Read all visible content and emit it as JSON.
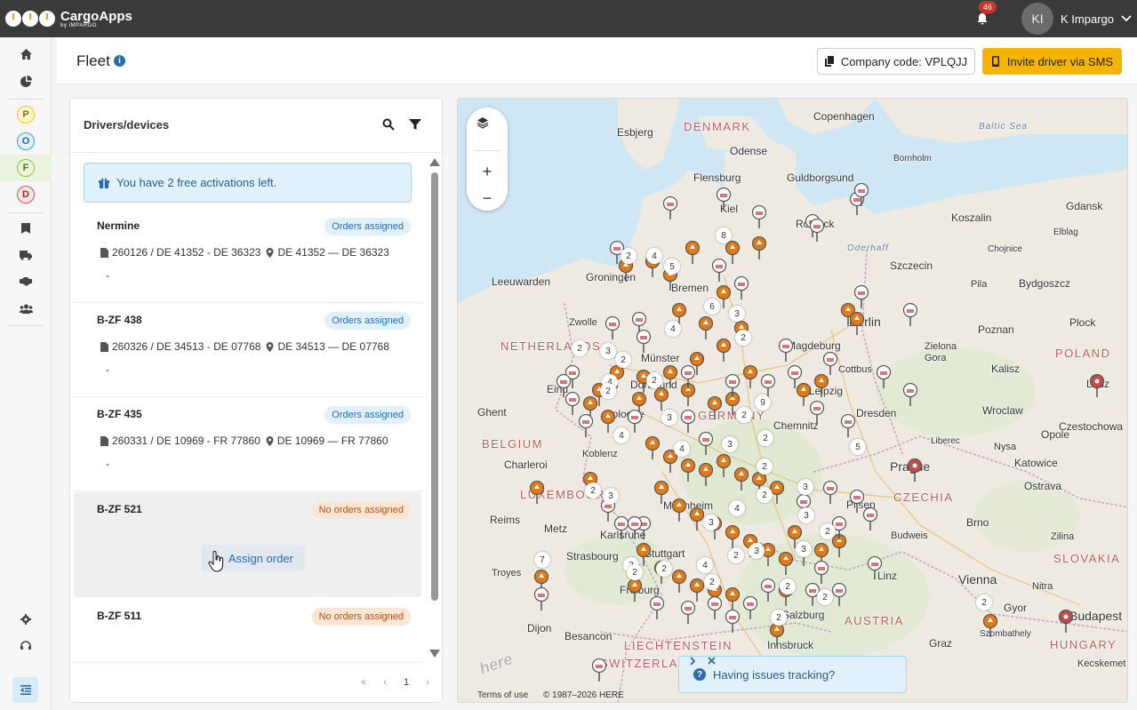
{
  "app": {
    "name": "CargoApps",
    "by": "by IMPARGO",
    "notifications_count": "46",
    "user_initials": "KI",
    "user_name": "K Impargo"
  },
  "sidebar": {
    "items": [
      {
        "name": "home-icon"
      },
      {
        "name": "chart-pie-icon"
      },
      {
        "letter": "P",
        "color": "#f5c518"
      },
      {
        "letter": "O",
        "color": "#3aa0e0"
      },
      {
        "letter": "F",
        "color": "#8bc34a"
      },
      {
        "letter": "D",
        "color": "#e05555"
      },
      {
        "name": "bookmark-icon"
      },
      {
        "name": "truck-icon"
      },
      {
        "name": "handshake-icon"
      },
      {
        "name": "users-icon"
      }
    ],
    "bottom": [
      {
        "name": "gear-icon"
      },
      {
        "name": "headset-icon"
      },
      {
        "name": "collapse-icon"
      }
    ]
  },
  "header": {
    "title": "Fleet",
    "company_code_label": "Company code: VPLQJJ",
    "invite_label": "Invite driver via SMS"
  },
  "panel": {
    "title": "Drivers/devices",
    "notice": "You have 2 free activations left.",
    "drivers": [
      {
        "name": "Nermine",
        "status": "Orders assigned",
        "order": "260126 / DE 41352 - DE 36323",
        "route": "DE 41352 — DE 36323",
        "vehicle": "-"
      },
      {
        "name": "B-ZF 438",
        "status": "Orders assigned",
        "order": "260326 / DE 34513 - DE 07768",
        "route": "DE 34513 — DE 07768",
        "vehicle": "-"
      },
      {
        "name": "B-ZF 435",
        "status": "Orders assigned",
        "order": "260331 / DE 10969 - FR 77860",
        "route": "DE 10969 — FR 77860",
        "vehicle": "-"
      },
      {
        "name": "B-ZF 521",
        "status": "No orders assigned",
        "assign_label": "Assign order"
      },
      {
        "name": "B-ZF 511",
        "status": "No orders assigned"
      }
    ],
    "pager": {
      "first": "«",
      "prev": "‹",
      "page": "1",
      "next": "›"
    }
  },
  "map": {
    "labels": [
      {
        "text": "Copenhagen"
      },
      {
        "text": "DENMARK"
      },
      {
        "text": "Esbjerg"
      },
      {
        "text": "Odense"
      },
      {
        "text": "Baltic Sea"
      },
      {
        "text": "Bornholm"
      },
      {
        "text": "Guldborgsund"
      },
      {
        "text": "Flensburg"
      },
      {
        "text": "Kiel"
      },
      {
        "text": "Rostock"
      },
      {
        "text": "Koszalin"
      },
      {
        "text": "Gdansk"
      },
      {
        "text": "Elblag"
      },
      {
        "text": "Chojnice"
      },
      {
        "text": "Oderhaff"
      },
      {
        "text": "Szczecin"
      },
      {
        "text": "Leeuwarden"
      },
      {
        "text": "Groningen"
      },
      {
        "text": "Bremen"
      },
      {
        "text": "Pila"
      },
      {
        "text": "Bydgoszcz"
      },
      {
        "text": "Berlin"
      },
      {
        "text": "Plock"
      },
      {
        "text": "Zwolle"
      },
      {
        "text": "Magdeburg"
      },
      {
        "text": "Poznan"
      },
      {
        "text": "NETHERLANDS"
      },
      {
        "text": "Münster"
      },
      {
        "text": "Zielona Gora"
      },
      {
        "text": "POLAND"
      },
      {
        "text": "Eind"
      },
      {
        "text": "Dortmund"
      },
      {
        "text": "Leipzig"
      },
      {
        "text": "Cottbus"
      },
      {
        "text": "Kalisz"
      },
      {
        "text": "Lodz"
      },
      {
        "text": "Ghent"
      },
      {
        "text": "Cologne"
      },
      {
        "text": "GERMANY"
      },
      {
        "text": "Dresden"
      },
      {
        "text": "Wroclaw"
      },
      {
        "text": "BELGIUM"
      },
      {
        "text": "Chemnitz"
      },
      {
        "text": "Liberec"
      },
      {
        "text": "Opole"
      },
      {
        "text": "Czestochowa"
      },
      {
        "text": "Nysa"
      },
      {
        "text": "Koblenz"
      },
      {
        "text": "Charleroi"
      },
      {
        "text": "Prague"
      },
      {
        "text": "Katowice"
      },
      {
        "text": "LUXEMBOURG"
      },
      {
        "text": "CZECHIA"
      },
      {
        "text": "Ostrava"
      },
      {
        "text": "Mannheim"
      },
      {
        "text": "Pilsen"
      },
      {
        "text": "Reims"
      },
      {
        "text": "Brno"
      },
      {
        "text": "Metz"
      },
      {
        "text": "Karlsruhe"
      },
      {
        "text": "Budweis"
      },
      {
        "text": "Zilina"
      },
      {
        "text": "Strasbourg"
      },
      {
        "text": "Stuttgart"
      },
      {
        "text": "SLOVAKIA"
      },
      {
        "text": "Troyes"
      },
      {
        "text": "Linz"
      },
      {
        "text": "Vienna"
      },
      {
        "text": "Freiburg"
      },
      {
        "text": "Nitra"
      },
      {
        "text": "Gyor"
      },
      {
        "text": "Budapest"
      },
      {
        "text": "Salzburg"
      },
      {
        "text": "Dijon"
      },
      {
        "text": "AUSTRIA"
      },
      {
        "text": "Szombathely"
      },
      {
        "text": "Besancon"
      },
      {
        "text": "Innsbruck"
      },
      {
        "text": "HUNGARY"
      },
      {
        "text": "LIECHTENSTEIN"
      },
      {
        "text": "Graz"
      },
      {
        "text": "SWITZERLAND"
      },
      {
        "text": "Kecskemet"
      }
    ],
    "footer_terms": "Terms of use",
    "footer_copy": "© 1987–2026 HERE",
    "watermark": "here",
    "tracking_label": "Having issues tracking?",
    "clusters": [
      "2",
      "4",
      "5",
      "8",
      "2",
      "6",
      "3",
      "4",
      "2",
      "2",
      "3",
      "4",
      "2",
      "2",
      "2",
      "3",
      "4",
      "4",
      "3",
      "2",
      "5",
      "2",
      "2",
      "3",
      "4",
      "3",
      "9",
      "2",
      "3",
      "3",
      "3",
      "2",
      "2",
      "2",
      "7",
      "2",
      "2",
      "2",
      "4",
      "2",
      "3",
      "2",
      "2",
      "2"
    ]
  },
  "colors": {
    "topbar": "#3a3a3a",
    "accent": "#f5b400",
    "link": "#2a6bb3",
    "pin_orange": "#e07b1a",
    "pin_red": "#c74a4a"
  }
}
